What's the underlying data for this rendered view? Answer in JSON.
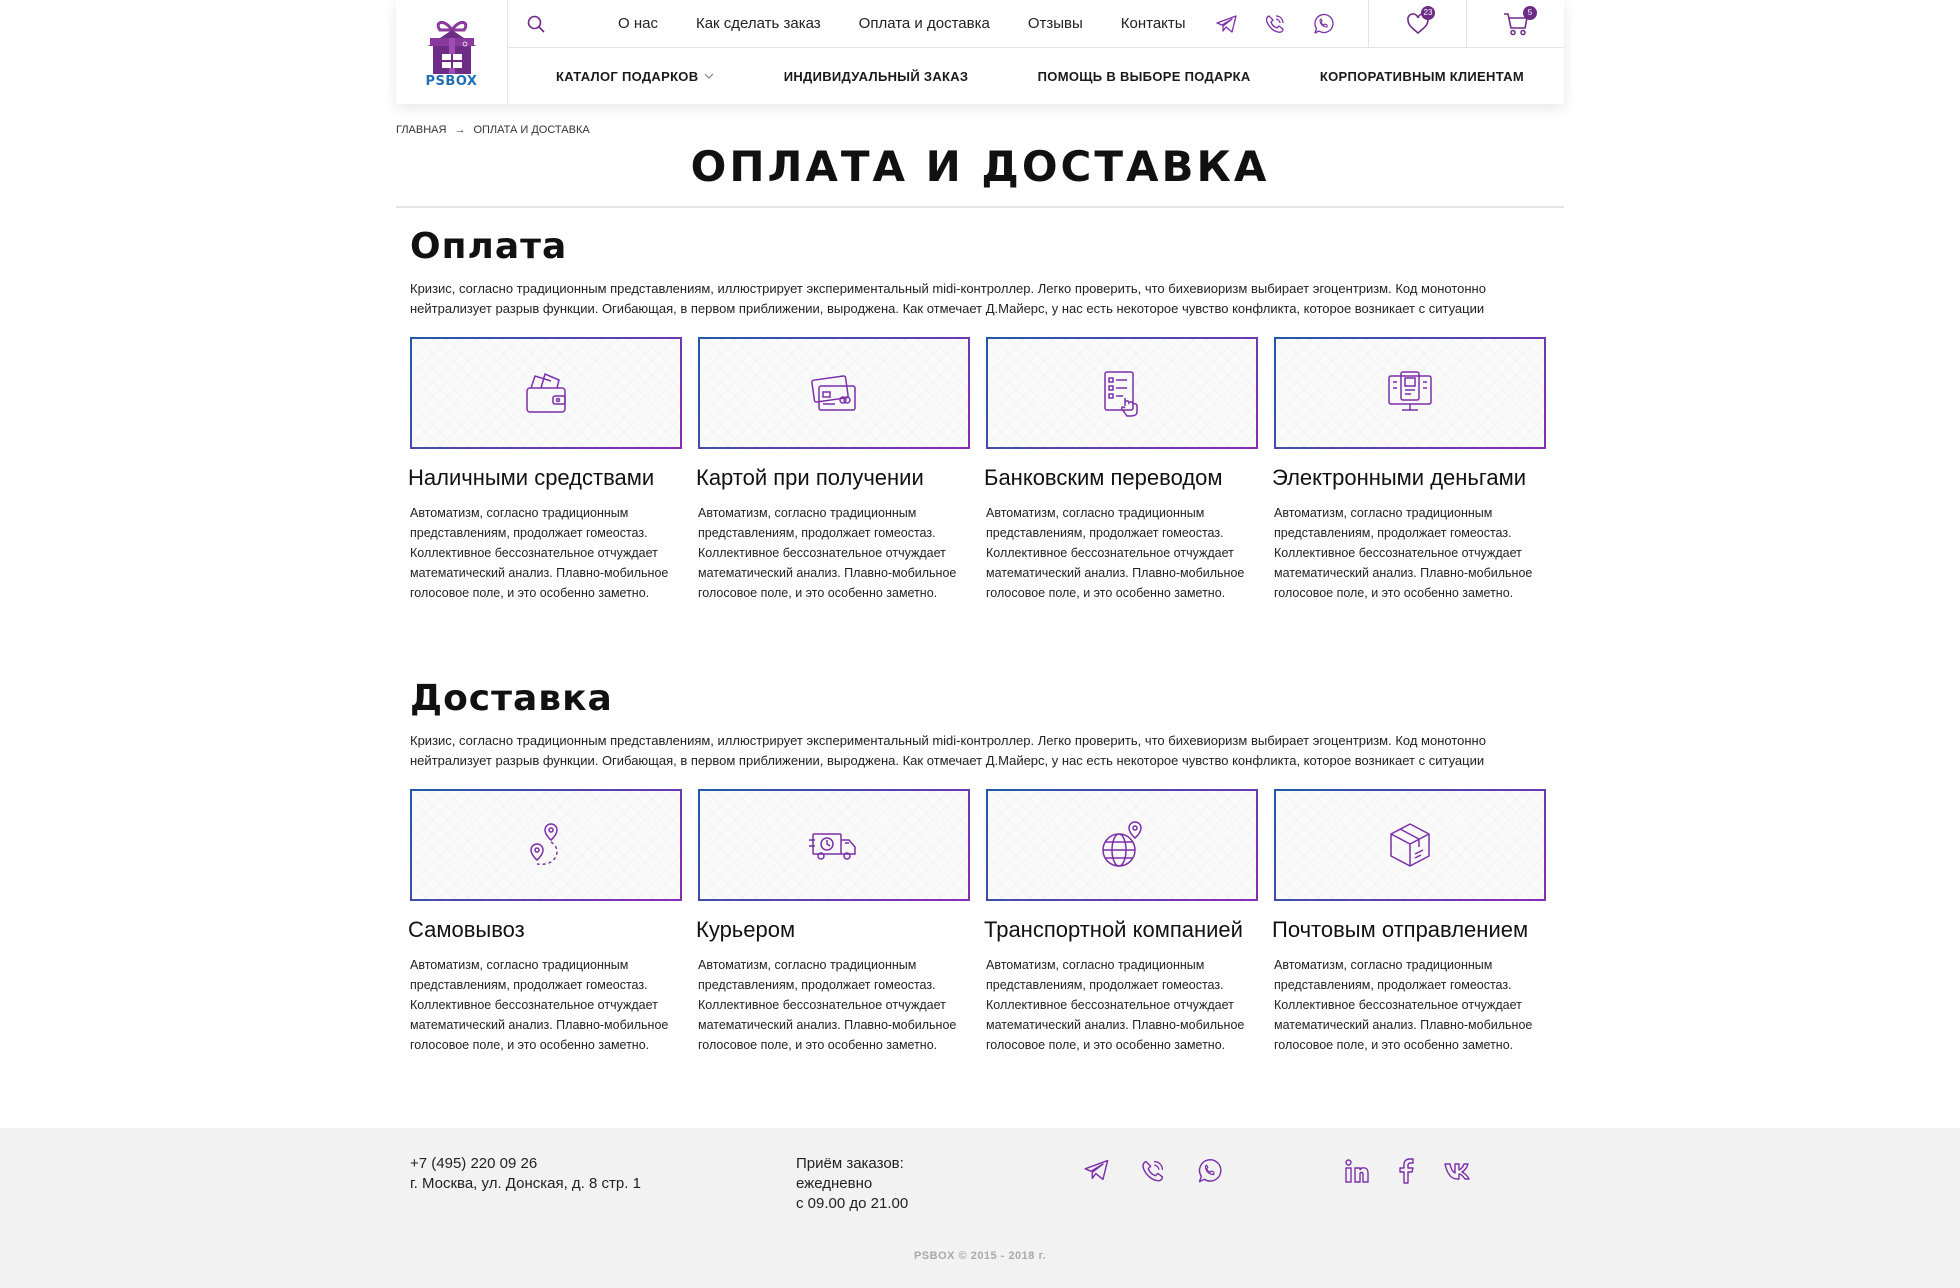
{
  "header": {
    "logo_text": "PSBOX",
    "nav_top": [
      "О нас",
      "Как сделать заказ",
      "Оплата и доставка",
      "Отзывы",
      "Контакты"
    ],
    "favorites_count": "23",
    "cart_count": "5",
    "nav_bottom": [
      "КАТАЛОГ ПОДАРКОВ",
      "ИНДИВИДУАЛЬНЫЙ ЗАКАЗ",
      "ПОМОЩЬ В ВЫБОРЕ ПОДАРКА",
      "КОРПОРАТИВНЫМ КЛИЕНТАМ"
    ]
  },
  "breadcrumb": {
    "home": "ГЛАВНАЯ",
    "arrow": "→",
    "current": "ОПЛАТА И ДОСТАВКА"
  },
  "page_title": "ОПЛАТА И ДОСТАВКА",
  "payment": {
    "title": "Оплата",
    "desc": "Кризис, согласно традиционным представлениям, иллюстрирует экспериментальный midi-контроллер. Легко проверить, что бихевиоризм выбирает эгоцентризм. Код монотонно нейтрализует разрыв функции. Огибающая, в первом приближении, выроджена. Как отмечает Д.Майерс, у нас есть некоторое чувство конфликта, которое возникает с ситуации",
    "cards": [
      {
        "title": "Наличными средствами",
        "icon": "wallet-icon",
        "text": "Автоматизм, согласно традиционным представлениям, продолжает гомеостаз. Коллективное бессознательное отчуждает математический анализ. Плавно-мобильное голосовое поле, и это особенно заметно."
      },
      {
        "title": "Картой при получении",
        "icon": "credit-card-icon",
        "text": "Автоматизм, согласно традиционным представлениям, продолжает гомеостаз. Коллективное бессознательное отчуждает математический анализ. Плавно-мобильное голосовое поле, и это особенно заметно."
      },
      {
        "title": "Банковским переводом",
        "icon": "bank-transfer-icon",
        "text": "Автоматизм, согласно традиционным представлениям, продолжает гомеостаз. Коллективное бессознательное отчуждает математический анализ. Плавно-мобильное голосовое поле, и это особенно заметно."
      },
      {
        "title": "Электронными деньгами",
        "icon": "e-money-icon",
        "text": "Автоматизм, согласно традиционным представлениям, продолжает гомеостаз. Коллективное бессознательное отчуждает математический анализ. Плавно-мобильное голосовое поле, и это особенно заметно."
      }
    ]
  },
  "delivery": {
    "title": "Доставка",
    "desc": "Кризис, согласно традиционным представлениям, иллюстрирует экспериментальный midi-контроллер. Легко проверить, что бихевиоризм выбирает эгоцентризм. Код монотонно нейтрализует разрыв функции. Огибающая, в первом приближении, выроджена. Как отмечает Д.Майерс, у нас есть некоторое чувство конфликта, которое возникает с ситуации",
    "cards": [
      {
        "title": "Самовывоз",
        "icon": "pickup-route-icon",
        "text": "Автоматизм, согласно традиционным представлениям, продолжает гомеостаз. Коллективное бессознательное отчуждает математический анализ. Плавно-мобильное голосовое поле, и это особенно заметно."
      },
      {
        "title": "Курьером",
        "icon": "courier-truck-icon",
        "text": "Автоматизм, согласно традиционным представлениям, продолжает гомеостаз. Коллективное бессознательное отчуждает математический анализ. Плавно-мобильное голосовое поле, и это особенно заметно."
      },
      {
        "title": "Транспортной компанией",
        "icon": "globe-pin-icon",
        "text": "Автоматизм, согласно традиционным представлениям, продолжает гомеостаз. Коллективное бессознательное отчуждает математический анализ. Плавно-мобильное голосовое поле, и это особенно заметно."
      },
      {
        "title": "Почтовым отправлением",
        "icon": "parcel-box-icon",
        "text": "Автоматизм, согласно традиционным представлениям, продолжает гомеостаз. Коллективное бессознательное отчуждает математический анализ. Плавно-мобильное голосовое поле, и это особенно заметно."
      }
    ]
  },
  "footer": {
    "phone": "+7 (495) 220 09 26",
    "address": "г. Москва, ул. Донская, д. 8 стр. 1",
    "hours_label": "Приём заказов:",
    "hours_days": "ежедневно",
    "hours_time": "с 09.00 до 21.00",
    "copyright": "PSBOX © 2015 - 2018 г."
  },
  "colors": {
    "accent": "#6d2c85",
    "icon_stroke": "#7b2fa8",
    "border_blue": "#1f5aa8",
    "border_purple": "#8b2bb8"
  }
}
